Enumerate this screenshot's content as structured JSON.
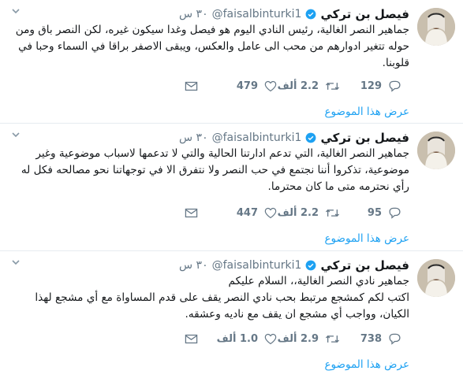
{
  "tweets": [
    {
      "name": "فيصل بن تركي",
      "handle": "@faisalbinturki1",
      "time": "٣٠ س",
      "lines": [
        "جماهير النصر الغالية، رئيس النادي اليوم هو فيصل وغدا سيكون غيره، لكن النصر باق ومن",
        "حوله تتغير ادوارهم من محب الى عامل والعكس، ويبقى الاصفر براقا في السماء وحبا في",
        "قلوبنا."
      ],
      "replies": "129",
      "retweets": "2.2 ألف",
      "likes": "479",
      "show_thread": "عرض هذا الموضوع"
    },
    {
      "name": "فيصل بن تركي",
      "handle": "@faisalbinturki1",
      "time": "٣٠ س",
      "lines": [
        "جماهير النصر الغالية، التي تدعم ادارتنا الحالية والتي لا تدعمها لاسباب موضوعية وغير",
        "موضوعية، تذكروا أننا نجتمع في حب النصر ولا نتفرق الا في توجهاتنا نحو مصالحه فكل له",
        "رأي نحترمه متى ما كان محترما."
      ],
      "replies": "95",
      "retweets": "2.2 ألف",
      "likes": "447",
      "show_thread": "عرض هذا الموضوع"
    },
    {
      "name": "فيصل بن تركي",
      "handle": "@faisalbinturki1",
      "time": "٣٠ س",
      "lines": [
        "جماهير نادي النصر الغالية،، السلام عليكم",
        "اكتب لكم كمشجع مرتبط بحب نادي النصر يقف على قدم المساواة مع أي مشجع لهذا",
        "الكيان، وواجب أي مشجع ان يقف مع ناديه وعشقه."
      ],
      "replies": "738",
      "retweets": "2.9 ألف",
      "likes": "1.0 ألف",
      "show_thread": "عرض هذا الموضوع"
    }
  ],
  "colors": {
    "text": "#14171a",
    "secondary": "#657786",
    "link": "#1da1f2",
    "verified": "#1da1f2",
    "divider": "#e6ecf0"
  },
  "icons": [
    "avatar",
    "verified-badge-icon",
    "chevron-down-icon",
    "reply-icon",
    "retweet-icon",
    "like-icon",
    "direct-message-icon"
  ]
}
